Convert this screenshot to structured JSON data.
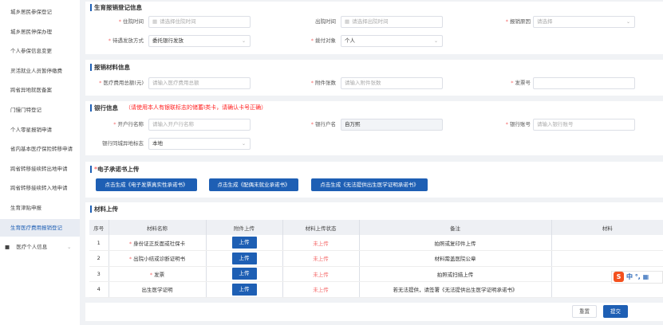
{
  "sidebar": {
    "items": [
      "城乡居民参保登记",
      "城乡居民停保办理",
      "个人参保信息变更",
      "灵活就业人员暂停缴费",
      "跨省异地就医备案",
      "门慢门特登记",
      "个人零星报销申请",
      "省内基本医疗保险转移申请",
      "跨省转移接续转出地申请",
      "跨省转移接续转入地申请",
      "生育津贴申报",
      "生育医疗费用报销登记"
    ],
    "active": "生育医疗费用报销登记",
    "group": "医疗个人信息"
  },
  "section1": {
    "title": "生育报销登记信息",
    "stay_label": "住院时间",
    "stay_placeholder": "请选择住院时间",
    "discharge_label": "出院时间",
    "discharge_placeholder": "请选择出院时间",
    "reason_label": "报销原因",
    "reason_placeholder": "请选择",
    "pay_method_label": "待遇发放方式",
    "pay_method_value": "委托银行发放",
    "pay_target_label": "拨付对象",
    "pay_target_value": "个人"
  },
  "section2": {
    "title": "报销材料信息",
    "total_label": "医疗费用总额(元)",
    "total_placeholder": "请输入医疗费用总额",
    "attach_label": "附件张数",
    "attach_placeholder": "请输入附件张数",
    "invoice_label": "发票号",
    "invoice_value": ""
  },
  "section3": {
    "title": "银行信息",
    "warning": "（请使用本人有银联标志的储蓄I类卡，请确认卡号正确）",
    "bank_name_label": "开户行名称",
    "bank_name_placeholder": "请输入开户行名称",
    "holder_label": "银行户名",
    "holder_value": "自万熙",
    "account_label": "银行账号",
    "account_placeholder": "请输入银行账号",
    "locality_label": "银行同城异地标志",
    "locality_value": "本地"
  },
  "section4": {
    "title": "电子承诺书上传",
    "buttons": [
      "点击生成《电子发票真实性承诺书》",
      "点击生成《配偶未就业承诺书》",
      "点击生成《无法提供出生医学证明承诺书》"
    ]
  },
  "section5": {
    "title": "材料上传",
    "headers": [
      "序号",
      "材料名称",
      "附件上传",
      "材料上传状态",
      "备注",
      "材料"
    ],
    "rows": [
      {
        "no": "1",
        "name": "身份证正反面或社保卡",
        "required": true,
        "upload": "上传",
        "status": "未上传",
        "note": "拍照或复印件上传",
        "material": ""
      },
      {
        "no": "2",
        "name": "出院小结或诊断证明书",
        "required": true,
        "upload": "上传",
        "status": "未上传",
        "note": "材料需盖医院公章",
        "material": ""
      },
      {
        "no": "3",
        "name": "发票",
        "required": true,
        "upload": "上传",
        "status": "未上传",
        "note": "拍照或扫描上传",
        "material": ""
      },
      {
        "no": "4",
        "name": "出生医学证明",
        "required": false,
        "upload": "上传",
        "status": "未上传",
        "note": "若无法提供，请签署《无法提供出生医学证明承诺书》",
        "material": ""
      }
    ]
  },
  "footer": {
    "reset": "重置",
    "submit": "提交"
  },
  "ime": {
    "logo": "S",
    "mode": "中",
    "punct": "°,"
  }
}
